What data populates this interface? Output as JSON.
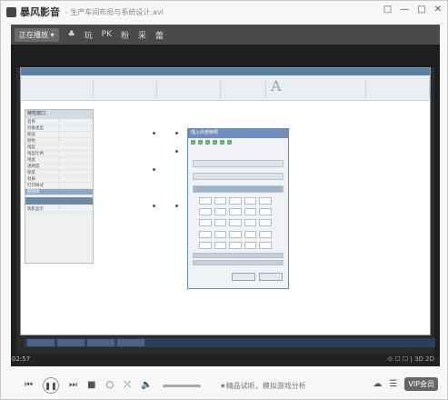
{
  "window": {
    "app_name": "暴风影音",
    "doc_title": "- 生产车间布局与系统设计.avi",
    "controls": [
      "□",
      "—",
      "□",
      "✕"
    ]
  },
  "toolbar": {
    "pill": "正在播放 ▾",
    "items": [
      "♣",
      "玩",
      "PK",
      "粉",
      "采",
      "蕾"
    ]
  },
  "player": {
    "time": "02:57",
    "right_tools": "⊙ ☐ ☐ | 3D 2D",
    "ad_text": "★精品试听，模拟游戏分析",
    "vip": "VIP会员"
  },
  "screen": {
    "panel_title": "特性窗口",
    "panel_rows": [
      [
        "名称",
        "·"
      ],
      [
        "对象类型",
        "·"
      ],
      [
        "图层",
        "·"
      ],
      [
        "颜色",
        "·"
      ],
      [
        "线型",
        "·"
      ],
      [
        "线型比例",
        "·"
      ],
      [
        "线宽",
        "·"
      ],
      [
        "透明度",
        "·"
      ],
      [
        "厚度",
        "·"
      ],
      [
        "材质",
        "·"
      ],
      [
        "打印样式",
        "·"
      ],
      [
        "超链接",
        "·"
      ],
      [
        "阴影显示",
        "·"
      ]
    ],
    "dialog_title": "插入外部参照",
    "big_letter": "A"
  }
}
